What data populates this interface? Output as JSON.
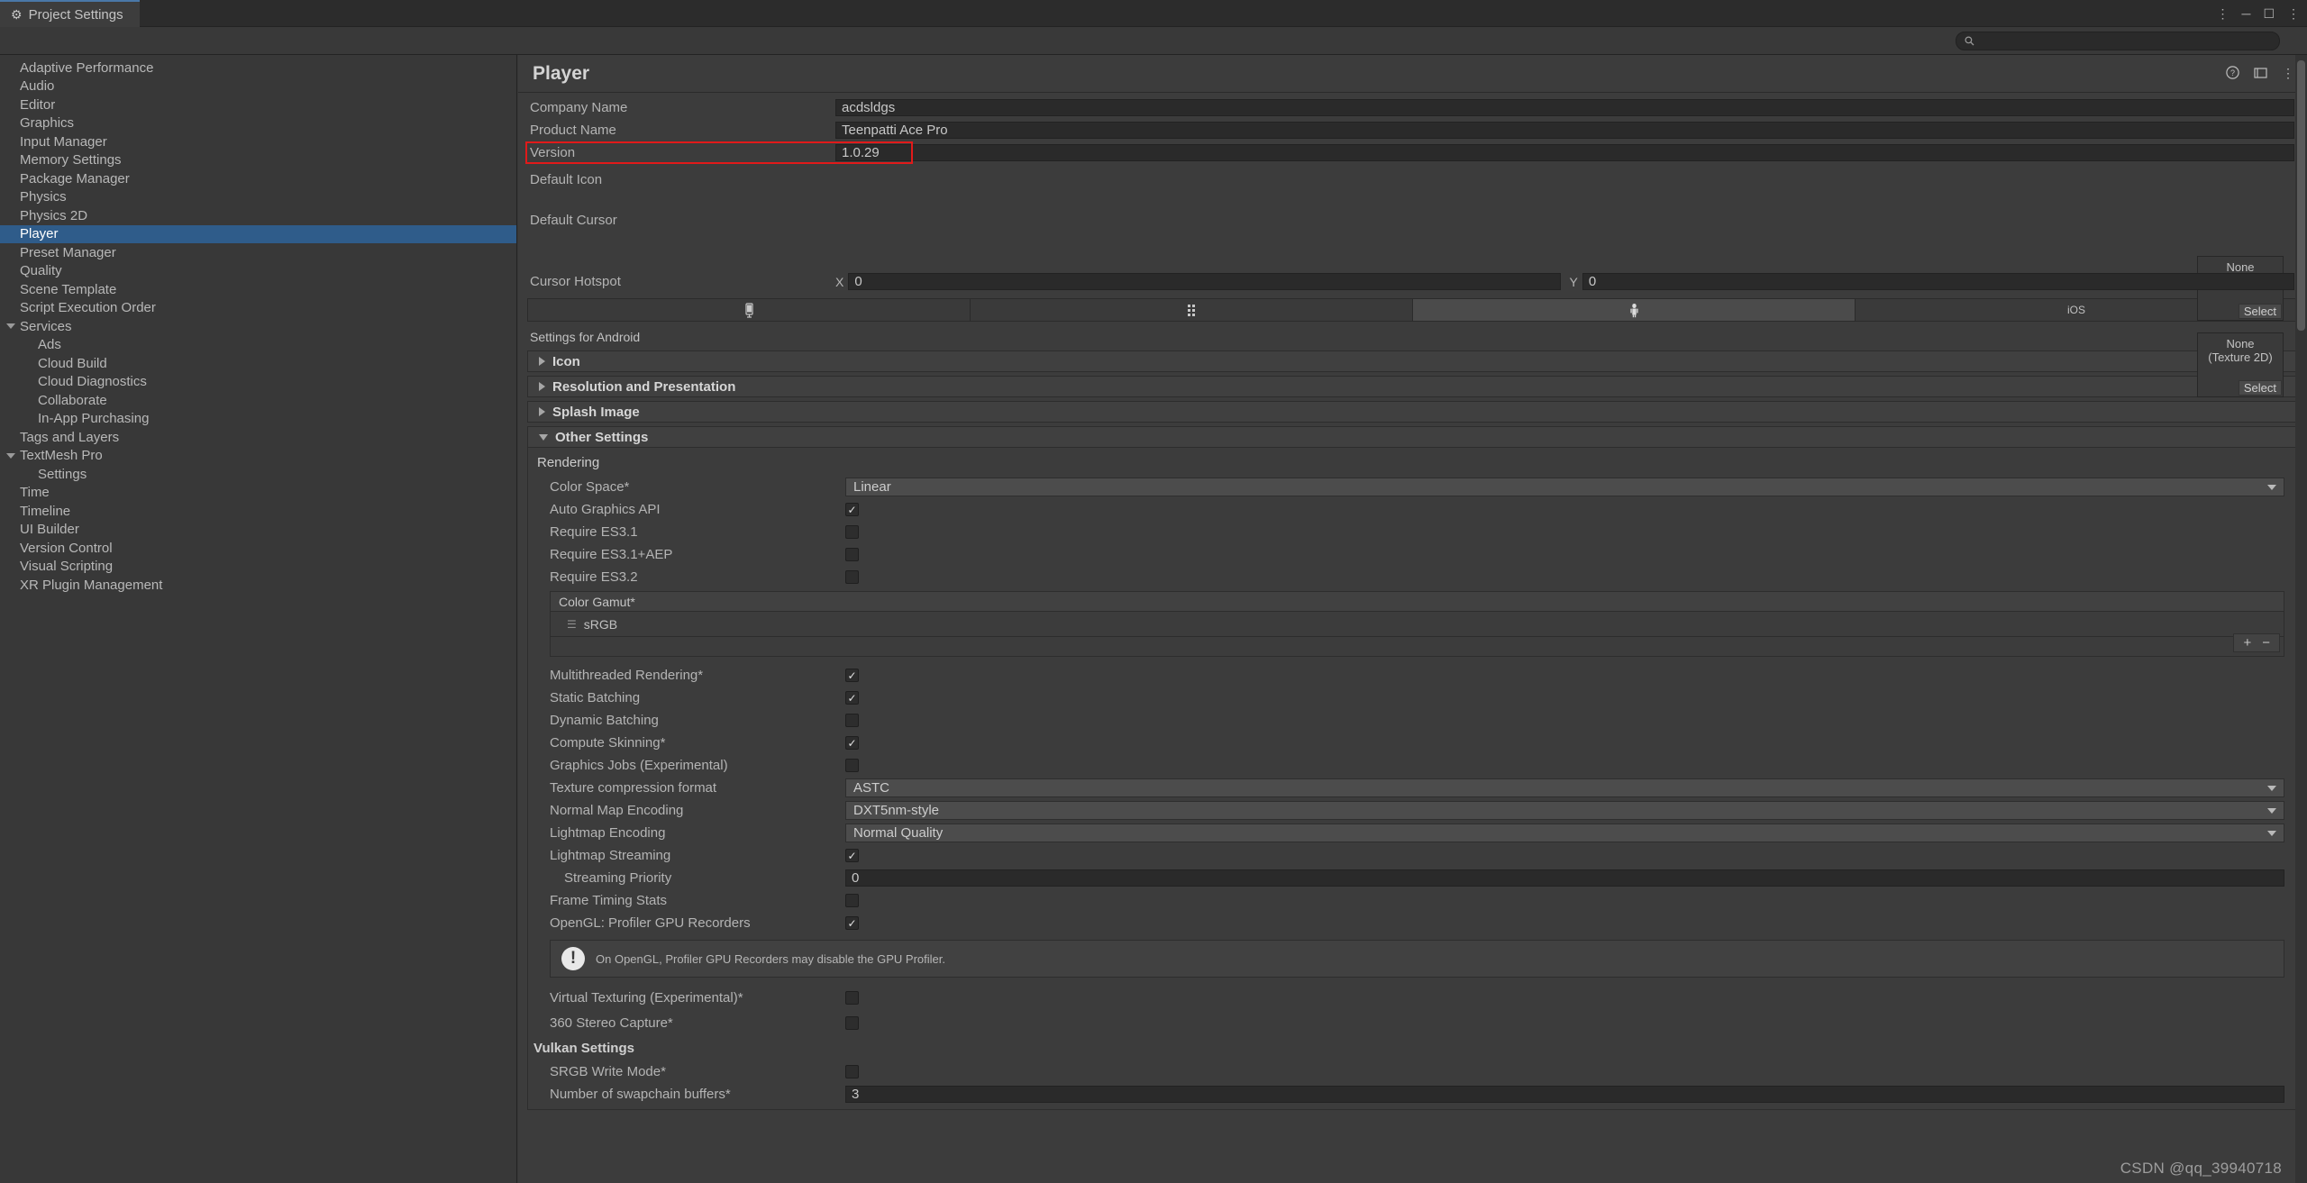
{
  "window": {
    "tab_title": "Project Settings",
    "tab_icon": "gear-icon",
    "menu_icon": "kebab-menu-icon",
    "minimize_icon": "minimize-icon",
    "maximize_icon": "maximize-icon",
    "close_icon": "close-icon"
  },
  "search": {
    "value": "",
    "placeholder": "",
    "icon": "search-icon"
  },
  "sidebar": {
    "items": [
      {
        "label": "Adaptive Performance",
        "level": 0,
        "selected": false,
        "arrow": "none"
      },
      {
        "label": "Audio",
        "level": 0,
        "selected": false,
        "arrow": "none"
      },
      {
        "label": "Editor",
        "level": 0,
        "selected": false,
        "arrow": "none"
      },
      {
        "label": "Graphics",
        "level": 0,
        "selected": false,
        "arrow": "none"
      },
      {
        "label": "Input Manager",
        "level": 0,
        "selected": false,
        "arrow": "none"
      },
      {
        "label": "Memory Settings",
        "level": 0,
        "selected": false,
        "arrow": "none"
      },
      {
        "label": "Package Manager",
        "level": 0,
        "selected": false,
        "arrow": "none"
      },
      {
        "label": "Physics",
        "level": 0,
        "selected": false,
        "arrow": "none"
      },
      {
        "label": "Physics 2D",
        "level": 0,
        "selected": false,
        "arrow": "none"
      },
      {
        "label": "Player",
        "level": 0,
        "selected": true,
        "arrow": "none"
      },
      {
        "label": "Preset Manager",
        "level": 0,
        "selected": false,
        "arrow": "none"
      },
      {
        "label": "Quality",
        "level": 0,
        "selected": false,
        "arrow": "none"
      },
      {
        "label": "Scene Template",
        "level": 0,
        "selected": false,
        "arrow": "none"
      },
      {
        "label": "Script Execution Order",
        "level": 0,
        "selected": false,
        "arrow": "none"
      },
      {
        "label": "Services",
        "level": 0,
        "selected": false,
        "arrow": "down"
      },
      {
        "label": "Ads",
        "level": 1,
        "selected": false,
        "arrow": "none"
      },
      {
        "label": "Cloud Build",
        "level": 1,
        "selected": false,
        "arrow": "none"
      },
      {
        "label": "Cloud Diagnostics",
        "level": 1,
        "selected": false,
        "arrow": "none"
      },
      {
        "label": "Collaborate",
        "level": 1,
        "selected": false,
        "arrow": "none"
      },
      {
        "label": "In-App Purchasing",
        "level": 1,
        "selected": false,
        "arrow": "none"
      },
      {
        "label": "Tags and Layers",
        "level": 0,
        "selected": false,
        "arrow": "none"
      },
      {
        "label": "TextMesh Pro",
        "level": 0,
        "selected": false,
        "arrow": "down"
      },
      {
        "label": "Settings",
        "level": 1,
        "selected": false,
        "arrow": "none"
      },
      {
        "label": "Time",
        "level": 0,
        "selected": false,
        "arrow": "none"
      },
      {
        "label": "Timeline",
        "level": 0,
        "selected": false,
        "arrow": "none"
      },
      {
        "label": "UI Builder",
        "level": 0,
        "selected": false,
        "arrow": "none"
      },
      {
        "label": "Version Control",
        "level": 0,
        "selected": false,
        "arrow": "none"
      },
      {
        "label": "Visual Scripting",
        "level": 0,
        "selected": false,
        "arrow": "none"
      },
      {
        "label": "XR Plugin Management",
        "level": 0,
        "selected": false,
        "arrow": "none"
      }
    ]
  },
  "panel": {
    "title": "Player",
    "help_icon": "help-icon",
    "preset_icon": "preset-icon",
    "menu_icon": "kebab-menu-icon"
  },
  "identity": {
    "company_name_label": "Company Name",
    "company_name_value": "acdsldgs",
    "product_name_label": "Product Name",
    "product_name_value": "Teenpatti Ace Pro",
    "version_label": "Version",
    "version_value": "1.0.29",
    "version_highlight_color": "#e11a1a",
    "default_icon_label": "Default Icon",
    "default_cursor_label": "Default Cursor",
    "cursor_hotspot_label": "Cursor Hotspot",
    "cursor_hotspot_x_label": "X",
    "cursor_hotspot_x_value": "0",
    "cursor_hotspot_y_label": "Y",
    "cursor_hotspot_y_value": "0",
    "object_none_line1": "None",
    "object_none_line2": "(Texture 2D)",
    "object_select_label": "Select"
  },
  "platform_tabs": [
    {
      "name": "standalone",
      "label": "",
      "icon": "monitor-icon",
      "active": false
    },
    {
      "name": "universal-windows",
      "label": "",
      "icon": "grid-blocks-icon",
      "active": false
    },
    {
      "name": "android",
      "label": "",
      "icon": "android-robot-icon",
      "active": true
    },
    {
      "name": "ios",
      "label": "iOS",
      "icon": "apple-icon",
      "active": false
    }
  ],
  "settings_for": "Settings for Android",
  "sections": [
    {
      "label": "Icon",
      "expanded": false
    },
    {
      "label": "Resolution and Presentation",
      "expanded": false
    },
    {
      "label": "Splash Image",
      "expanded": false
    },
    {
      "label": "Other Settings",
      "expanded": true
    }
  ],
  "other_settings": {
    "rendering_group": "Rendering",
    "color_space_label": "Color Space*",
    "color_space_value": "Linear",
    "auto_graphics_api_label": "Auto Graphics API",
    "auto_graphics_api_checked": true,
    "require_es31_label": "Require ES3.1",
    "require_es31_checked": false,
    "require_es31aep_label": "Require ES3.1+AEP",
    "require_es31aep_checked": false,
    "require_es32_label": "Require ES3.2",
    "require_es32_checked": false,
    "color_gamut_label": "Color Gamut*",
    "color_gamut_items": [
      "sRGB"
    ],
    "add_button": "+",
    "remove_button": "−",
    "toggles": [
      {
        "label": "Multithreaded Rendering*",
        "checked": true
      },
      {
        "label": "Static Batching",
        "checked": true
      },
      {
        "label": "Dynamic Batching",
        "checked": false
      },
      {
        "label": "Compute Skinning*",
        "checked": true
      },
      {
        "label": "Graphics Jobs (Experimental)",
        "checked": false
      }
    ],
    "texture_compression_label": "Texture compression format",
    "texture_compression_value": "ASTC",
    "normal_map_encoding_label": "Normal Map Encoding",
    "normal_map_encoding_value": "DXT5nm-style",
    "lightmap_encoding_label": "Lightmap Encoding",
    "lightmap_encoding_value": "Normal Quality",
    "lightmap_streaming_label": "Lightmap Streaming",
    "lightmap_streaming_checked": true,
    "streaming_priority_label": "Streaming Priority",
    "streaming_priority_value": "0",
    "frame_timing_stats_label": "Frame Timing Stats",
    "frame_timing_stats_checked": false,
    "opengl_profiler_label": "OpenGL: Profiler GPU Recorders",
    "opengl_profiler_checked": true,
    "warning_icon": "warning-icon",
    "warning_text": "On OpenGL, Profiler GPU Recorders may disable the GPU Profiler.",
    "virtual_texturing_label": "Virtual Texturing (Experimental)*",
    "virtual_texturing_checked": false,
    "stereo_capture_label": "360 Stereo Capture*",
    "stereo_capture_checked": false,
    "vulkan_group": "Vulkan Settings",
    "srgb_write_mode_label": "SRGB Write Mode*",
    "srgb_write_mode_checked": false,
    "swapchain_buffers_label": "Number of swapchain buffers*",
    "swapchain_buffers_value": "3"
  },
  "watermark": "CSDN @qq_39940718"
}
